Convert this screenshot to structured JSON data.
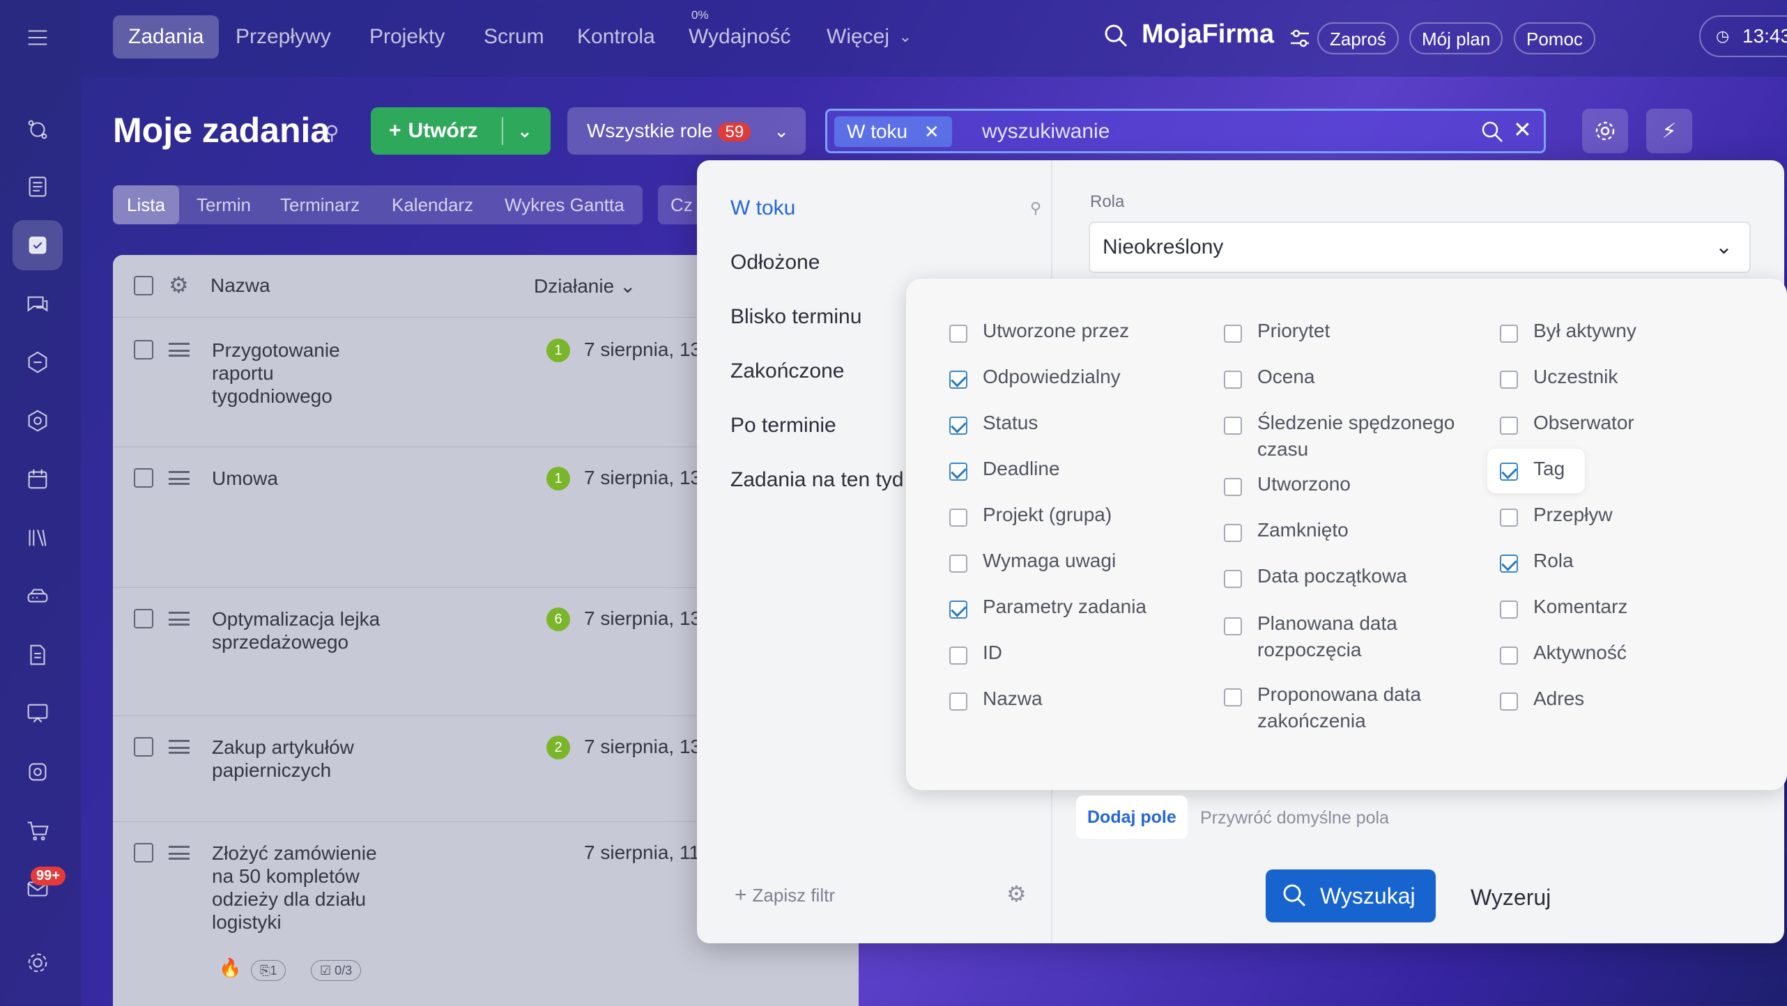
{
  "topnav": {
    "items": [
      "Zadania",
      "Przepływy",
      "Projekty",
      "Scrum",
      "Kontrola",
      "Wydajność",
      "Więcej"
    ],
    "efficiency_percent": "0%",
    "brand": "MojaFirma",
    "invite": "Zaproś",
    "my_plan": "Mój plan",
    "help": "Pomoc",
    "time": "13:43"
  },
  "sidebar": {
    "mail_badge": "99+"
  },
  "header": {
    "title": "Moje zadania",
    "create": "Utwórz",
    "roles": "Wszystkie role",
    "roles_count": "59",
    "chip": "W toku",
    "search_placeholder": "wyszukiwanie"
  },
  "view_tabs": [
    "Lista",
    "Termin",
    "Terminarz",
    "Kalendarz",
    "Wykres Gantta"
  ],
  "view_tab_extra": "Cz",
  "task_list": {
    "col_name": "Nazwa",
    "col_action": "Działanie",
    "rows": [
      {
        "name": "Przygotowanie raportu tygodniowego",
        "badge": "1",
        "date": "7 sierpnia, 13"
      },
      {
        "name": "Umowa",
        "badge": "1",
        "date": "7 sierpnia, 13"
      },
      {
        "name": "Optymalizacja lejka sprzedażowego",
        "badge": "6",
        "date": "7 sierpnia, 13"
      },
      {
        "name": "Zakup artykułów papierniczych",
        "badge": "2",
        "date": "7 sierpnia, 13"
      },
      {
        "name": "Złożyć zamówienie na 50 kompletów odzieży dla działu logistyki",
        "badge": "",
        "date": "7 sierpnia, 11"
      }
    ],
    "last_row_meta": {
      "attachments": "1",
      "checklist": "0/3"
    }
  },
  "filter": {
    "presets": [
      "W toku",
      "Odłożone",
      "Blisko terminu",
      "Zakończone",
      "Po terminie",
      "Zadania na ten tyd"
    ],
    "role_label": "Rola",
    "role_value": "Nieokreślony",
    "fields": {
      "col1": [
        {
          "label": "Utworzone przez",
          "checked": false
        },
        {
          "label": "Odpowiedzialny",
          "checked": true
        },
        {
          "label": "Status",
          "checked": true
        },
        {
          "label": "Deadline",
          "checked": true
        },
        {
          "label": "Projekt (grupa)",
          "checked": false
        },
        {
          "label": "Wymaga uwagi",
          "checked": false
        },
        {
          "label": "Parametry zadania",
          "checked": true
        },
        {
          "label": "ID",
          "checked": false
        },
        {
          "label": "Nazwa",
          "checked": false
        }
      ],
      "col2": [
        {
          "label": "Priorytet",
          "checked": false
        },
        {
          "label": "Ocena",
          "checked": false
        },
        {
          "label": "Śledzenie spędzonego czasu",
          "checked": false
        },
        {
          "label": "Utworzono",
          "checked": false
        },
        {
          "label": "Zamknięto",
          "checked": false
        },
        {
          "label": "Data początkowa",
          "checked": false
        },
        {
          "label": "Planowana data rozpoczęcia",
          "checked": false
        },
        {
          "label": "Proponowana data zakończenia",
          "checked": false
        }
      ],
      "col3": [
        {
          "label": "Był aktywny",
          "checked": false
        },
        {
          "label": "Uczestnik",
          "checked": false
        },
        {
          "label": "Obserwator",
          "checked": false
        },
        {
          "label": "Tag",
          "checked": true
        },
        {
          "label": "Przepływ",
          "checked": false
        },
        {
          "label": "Rola",
          "checked": true
        },
        {
          "label": "Komentarz",
          "checked": false
        },
        {
          "label": "Aktywność",
          "checked": false
        },
        {
          "label": "Adres",
          "checked": false
        }
      ]
    },
    "add_field": "Dodaj pole",
    "restore_default": "Przywróć domyślne pola",
    "save_filter": "Zapisz filtr",
    "search_button": "Wyszukaj",
    "reset_button": "Wyzeruj"
  }
}
